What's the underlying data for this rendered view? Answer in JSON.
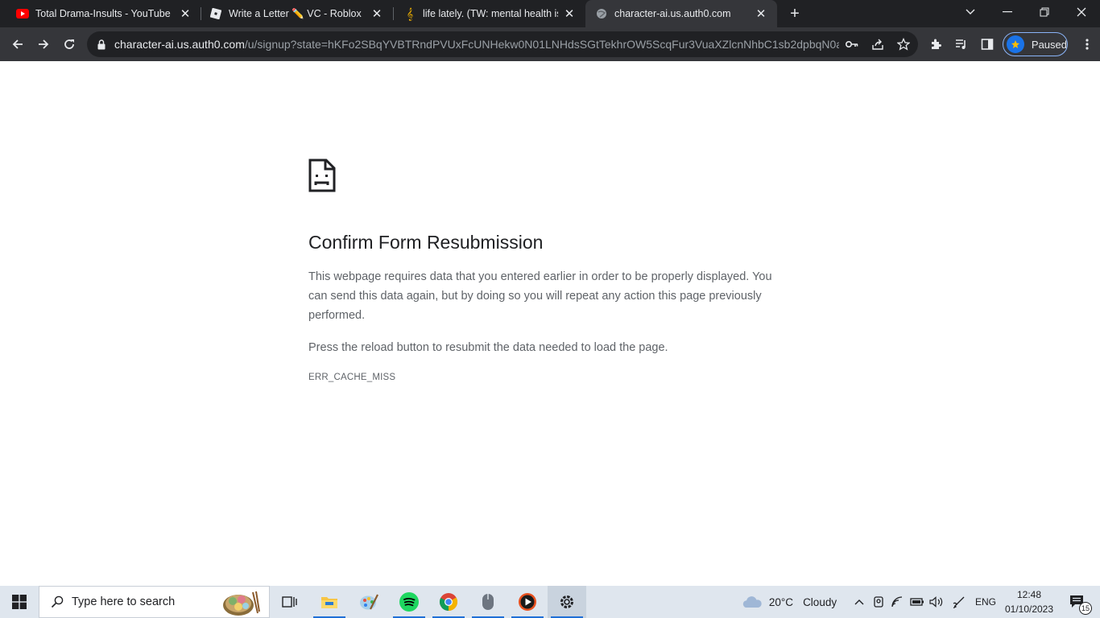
{
  "tabs": [
    {
      "title": "Total Drama-Insults - YouTube",
      "favicon": "youtube-icon",
      "active": false
    },
    {
      "title": "Write a Letter ✏️ VC - Roblox",
      "favicon": "roblox-icon",
      "active": false
    },
    {
      "title": "life lately. (TW: mental health iss",
      "favicon": "music-note-icon",
      "active": false
    },
    {
      "title": "character-ai.us.auth0.com",
      "favicon": "globe-icon",
      "active": true
    }
  ],
  "omnibox": {
    "host": "character-ai.us.auth0.com",
    "path": "/u/signup?state=hKFo2SBqYVBTRndPVUxFcUNHekw0N01LNHdsSGtTekhrOW5ScqFur3VuaXZlcnNhbC1sb2dpbqN0aW..."
  },
  "profile": {
    "label": "Paused"
  },
  "error_page": {
    "title": "Confirm Form Resubmission",
    "paragraph1": "This webpage requires data that you entered earlier in order to be properly displayed. You can send this data again, but by doing so you will repeat any action this page previously performed.",
    "paragraph2": "Press the reload button to resubmit the data needed to load the page.",
    "error_code": "ERR_CACHE_MISS"
  },
  "taskbar": {
    "search_placeholder": "Type here to search",
    "apps": [
      "task-view-icon",
      "file-explorer-icon",
      "paint-icon",
      "spotify-icon",
      "chrome-icon",
      "mouse-app-icon",
      "media-player-icon",
      "settings-icon"
    ],
    "weather": {
      "temp": "20°C",
      "condition": "Cloudy"
    },
    "language": "ENG",
    "time": "12:48",
    "date": "01/10/2023",
    "notifications": "15"
  },
  "colors": {
    "tabstrip": "#202124",
    "toolbar": "#35363a",
    "accent": "#8ab4f8",
    "taskbar": "#dfe6ee"
  }
}
